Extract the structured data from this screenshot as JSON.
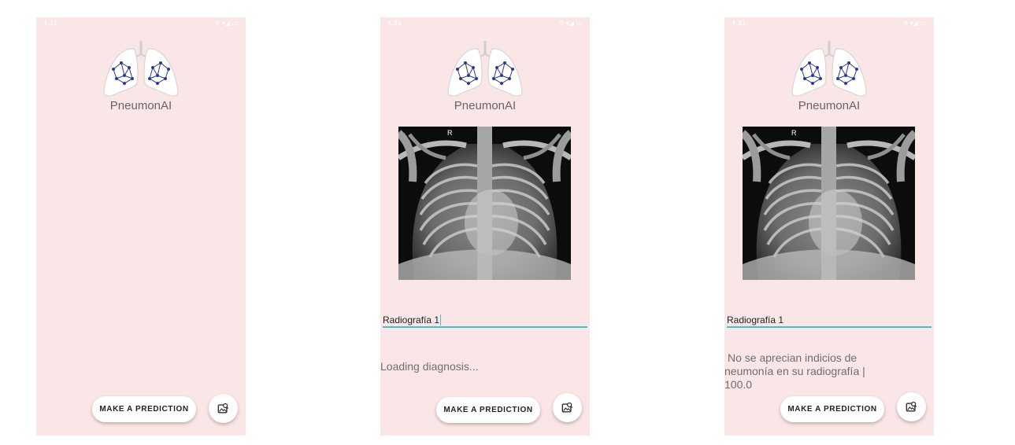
{
  "screens": [
    {
      "status_time": "4:31",
      "status_icons": "⚲ ▾◢ ▭",
      "app_title": "PneumonAI",
      "predict_label": "MAKE A PREDICTION",
      "pick_image_icon": "image-search-icon"
    },
    {
      "status_time": "4:31",
      "status_icons": "⚲ ▾◢ ▭",
      "app_title": "PneumonAI",
      "xray_marker": "R",
      "name_value": "Radiografía 1",
      "status_text": "Loading diagnosis...",
      "predict_label": "MAKE A PREDICTION",
      "pick_image_icon": "image-search-icon"
    },
    {
      "status_time": "4:31",
      "status_icons": "⚲ ▾◢ ▭",
      "app_title": "PneumonAI",
      "xray_marker": "R",
      "name_value": "Radiografía 1",
      "result_text": "No se aprecian indicios de neumonía en su radiografía | 100.0",
      "predict_label": "MAKE A PREDICTION",
      "pick_image_icon": "image-search-icon"
    }
  ],
  "colors": {
    "background": "#fbe6e7",
    "accent": "#3ec6c6",
    "logo_nodes": "#2b3a8f"
  }
}
